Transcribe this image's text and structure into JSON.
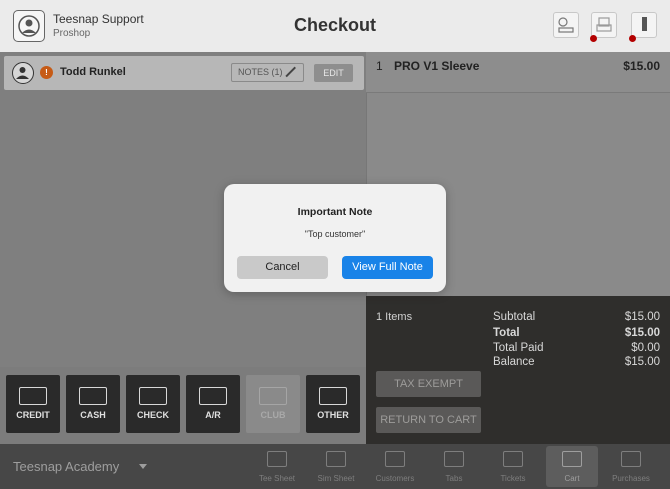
{
  "header": {
    "user_name": "Teesnap Support",
    "user_location": "Proshop",
    "title": "Checkout",
    "icons": [
      "register-icon",
      "printer-icon",
      "cash-drawer-icon"
    ]
  },
  "customer": {
    "badge": "!",
    "name": "Todd Runkel",
    "notes_label": "NOTES (1)",
    "edit_label": "EDIT"
  },
  "cart": {
    "items": [
      {
        "qty": "1",
        "name": "PRO V1 Sleeve",
        "price": "$15.00"
      }
    ]
  },
  "totals": {
    "items_count": "1 Items",
    "subtotal_label": "Subtotal",
    "subtotal": "$15.00",
    "total_label": "Total",
    "total": "$15.00",
    "paid_label": "Total Paid",
    "paid": "$0.00",
    "balance_label": "Balance",
    "balance": "$15.00",
    "tax_exempt": "TAX EXEMPT",
    "return_to_cart": "RETURN TO CART"
  },
  "payments": [
    {
      "label": "CREDIT",
      "icon": "credit-card-icon",
      "enabled": true
    },
    {
      "label": "CASH",
      "icon": "cash-icon",
      "enabled": true
    },
    {
      "label": "CHECK",
      "icon": "check-icon",
      "enabled": true
    },
    {
      "label": "A/R",
      "icon": "ledger-icon",
      "enabled": true
    },
    {
      "label": "CLUB",
      "icon": "club-ticket-icon",
      "enabled": false
    },
    {
      "label": "OTHER",
      "icon": "other-payment-icon",
      "enabled": true
    }
  ],
  "bottom_nav": {
    "facility": "Teesnap Academy",
    "items": [
      {
        "label": "Tee Sheet",
        "icon": "calendar-icon"
      },
      {
        "label": "Sim Sheet",
        "icon": "monitor-icon"
      },
      {
        "label": "Customers",
        "icon": "people-icon"
      },
      {
        "label": "Tabs",
        "icon": "tabs-icon"
      },
      {
        "label": "Tickets",
        "icon": "cloche-icon"
      },
      {
        "label": "Cart",
        "icon": "cart-icon",
        "active": true
      },
      {
        "label": "Purchases",
        "icon": "register-icon"
      }
    ]
  },
  "modal": {
    "title": "Important Note",
    "message": "\"Top customer\"",
    "cancel": "Cancel",
    "view_full": "View Full Note"
  },
  "colors": {
    "accent": "#1983e8",
    "badge": "#c65b16",
    "alert_dot": "#b30000"
  }
}
